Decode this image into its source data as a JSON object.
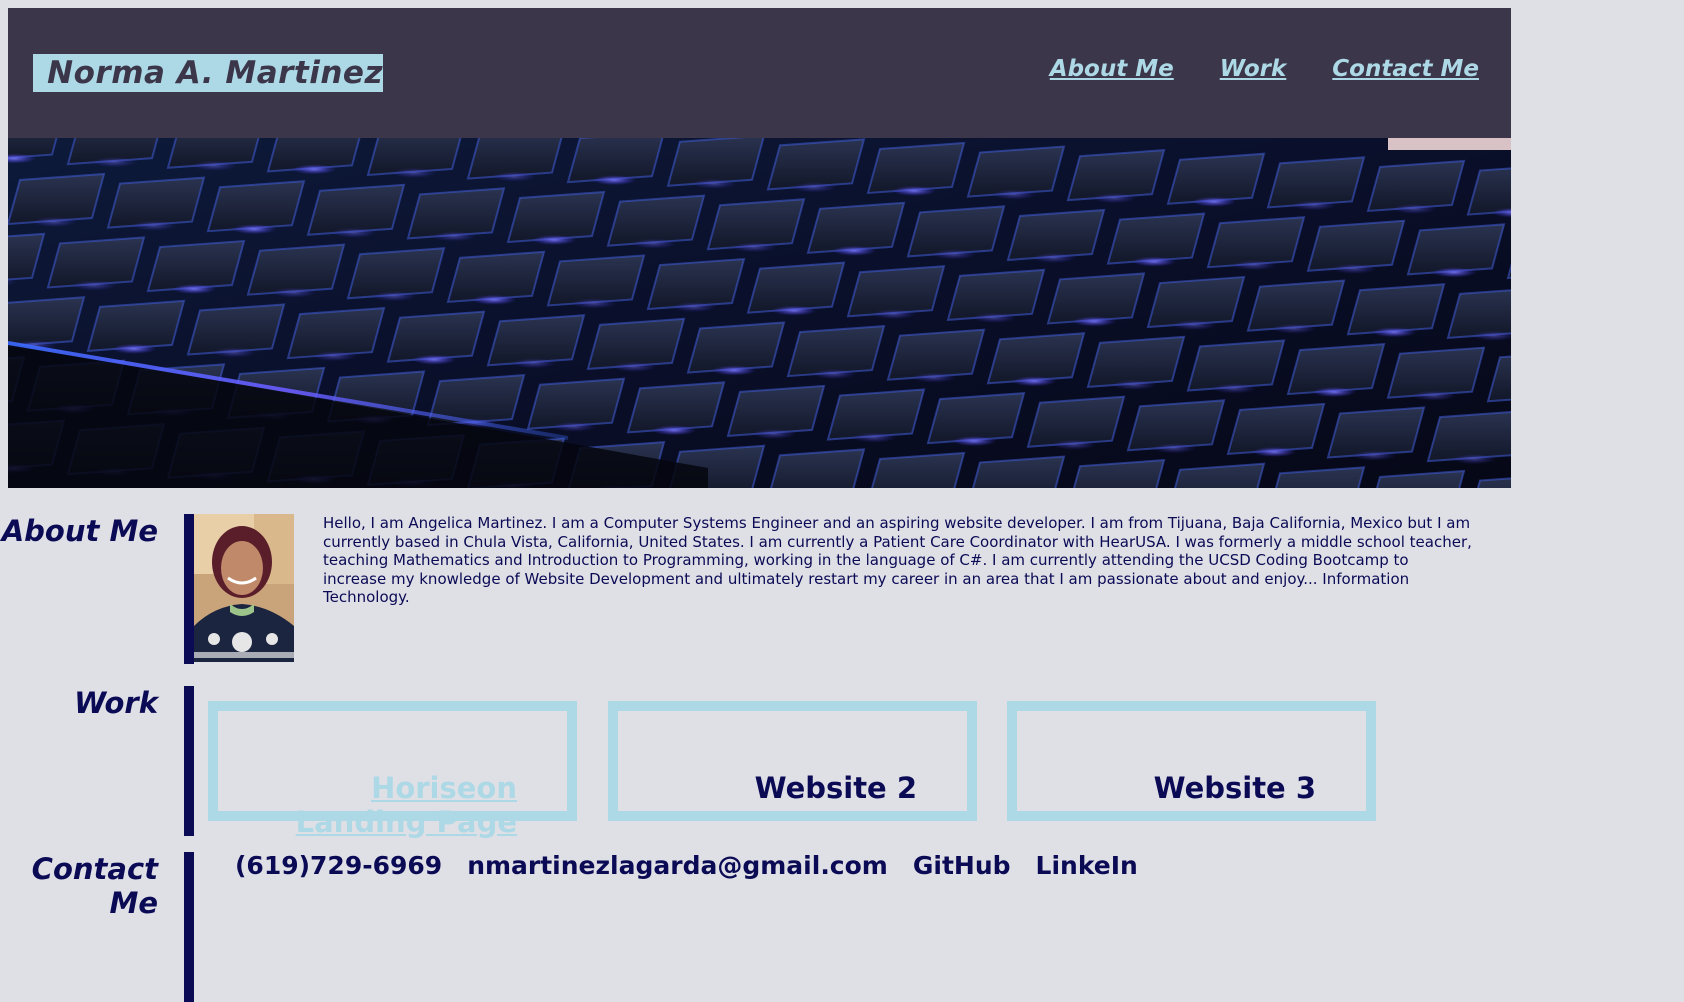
{
  "header": {
    "name": "Norma A. Martinez",
    "nav": [
      "About Me",
      "Work",
      "Contact Me"
    ]
  },
  "about": {
    "title": "About Me",
    "bio": "Hello, I am Angelica Martinez. I am a Computer Systems Engineer and an aspiring website developer. I am from Tijuana, Baja California, Mexico but I am currently based in Chula Vista, California, United States. I am currently a Patient Care Coordinator with HearUSA. I was formerly a middle school teacher, teaching Mathematics and Introduction to Programming, working in the language of C#. I am currently attending the UCSD Coding Bootcamp to increase my knowledge of Website Development and ultimately restart my career in an area that I am passionate about and enjoy... Information Technology."
  },
  "work": {
    "title": "Work",
    "cards": [
      "Horiseon Landing Page",
      "Website 2",
      "Website 3"
    ]
  },
  "contact": {
    "title": "Contact Me",
    "phone": "(619)729-6969",
    "email": "nmartinezlagarda@gmail.com",
    "github": "GitHub",
    "linkedin": "LinkeIn"
  },
  "colors": {
    "header_bg": "#3b3649",
    "accent_light_blue": "#add8e6",
    "navy": "#0b0a55",
    "page_bg": "#dfe0e6"
  }
}
